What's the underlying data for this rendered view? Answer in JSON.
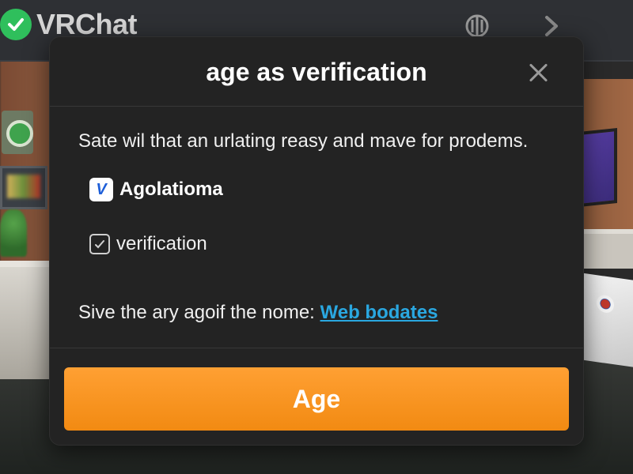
{
  "app": {
    "brand_name": "VRChat",
    "brand_icon": "check-circle-icon",
    "accent_green": "#2fbf5c"
  },
  "topbar": {
    "icons": [
      "globe-icon",
      "chevron-right-icon"
    ]
  },
  "dialog": {
    "title": "age as verification",
    "close_icon": "close-icon",
    "description": "Sate wil that an urlating reasy and mave for prodems.",
    "options": [
      {
        "icon": "app-logo-icon",
        "icon_glyph": "V",
        "label": "Agolatioma"
      },
      {
        "icon": "checkbox-icon",
        "label": "verification",
        "checked": true
      }
    ],
    "hint": {
      "text": "Sive the ary agoif the nome:",
      "link_text": "Web bodates",
      "link_color": "#2aa7e0"
    },
    "primary_button": {
      "label": "Age",
      "color": "#f7931e"
    }
  }
}
